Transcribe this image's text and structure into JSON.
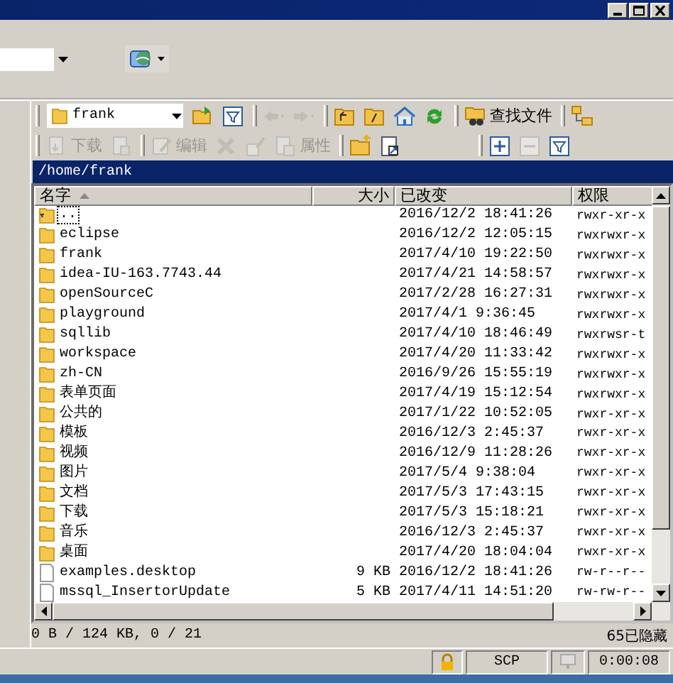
{
  "top_bar": {
    "globe_menu": true
  },
  "toolbar_1": {
    "path": "frank",
    "groups": [
      [
        {
          "kind": "open-folder",
          "disabled": false
        },
        {
          "kind": "filter",
          "disabled": false
        }
      ],
      [
        {
          "kind": "back",
          "disabled": true
        },
        {
          "kind": "forward",
          "disabled": true
        }
      ],
      [
        {
          "kind": "parent",
          "disabled": false
        },
        {
          "kind": "root",
          "disabled": false
        },
        {
          "kind": "home",
          "disabled": false
        },
        {
          "kind": "refresh",
          "disabled": false
        }
      ],
      [
        {
          "kind": "find",
          "label": "查找文件",
          "disabled": false
        }
      ],
      [
        {
          "kind": "tree",
          "disabled": false
        }
      ]
    ]
  },
  "toolbar_2": {
    "groups": [
      [
        {
          "kind": "download",
          "label": "下载",
          "disabled": true
        },
        {
          "kind": "download-options",
          "disabled": true
        }
      ],
      [
        {
          "kind": "edit",
          "label": "编辑",
          "disabled": true
        },
        {
          "kind": "delete",
          "disabled": true
        },
        {
          "kind": "rename",
          "disabled": true
        },
        {
          "kind": "properties",
          "label": "属性",
          "disabled": true
        }
      ],
      [
        {
          "kind": "new-folder",
          "disabled": false
        },
        {
          "kind": "shortcut",
          "disabled": false
        }
      ],
      [
        {
          "kind": "select",
          "disabled": false
        },
        {
          "kind": "unselect",
          "disabled": true
        },
        {
          "kind": "filter",
          "disabled": false
        }
      ]
    ]
  },
  "path_header": "/home/frank",
  "table": {
    "columns": [
      {
        "label": "名字",
        "sorted": true
      },
      {
        "label": "大小",
        "sorted": false
      },
      {
        "label": "已改变",
        "sorted": false
      },
      {
        "label": "权限",
        "sorted": false
      }
    ],
    "rows": [
      {
        "kind": "parent",
        "name": "..",
        "size": "",
        "changed": "2016/12/2 18:41:26",
        "permissions": "rwxr-xr-x",
        "focused": true
      },
      {
        "kind": "folder",
        "name": "eclipse",
        "changed": "2016/12/2 12:05:15",
        "permissions": "rwxrwxr-x",
        "focused": false
      },
      {
        "kind": "folder",
        "name": "frank",
        "changed": "2017/4/10 19:22:50",
        "permissions": "rwxrwxr-x",
        "focused": false
      },
      {
        "kind": "folder",
        "name": "idea-IU-163.7743.44",
        "changed": "2017/4/21 14:58:57",
        "permissions": "rwxrwxr-x",
        "focused": false
      },
      {
        "kind": "folder",
        "name": "openSourceC",
        "changed": "2017/2/28 16:27:31",
        "permissions": "rwxrwxr-x",
        "focused": false
      },
      {
        "kind": "folder",
        "name": "playground",
        "changed": "2017/4/1 9:36:45",
        "permissions": "rwxrwxr-x",
        "focused": false
      },
      {
        "kind": "folder",
        "name": "sqllib",
        "changed": "2017/4/10 18:46:49",
        "permissions": "rwxrwsr-t",
        "focused": false
      },
      {
        "kind": "folder",
        "name": "workspace",
        "changed": "2017/4/20 11:33:42",
        "permissions": "rwxrwxr-x",
        "focused": false
      },
      {
        "kind": "folder",
        "name": "zh-CN",
        "changed": "2016/9/26 15:55:19",
        "permissions": "rwxrwxr-x",
        "focused": false
      },
      {
        "kind": "folder",
        "name": "表单页面",
        "changed": "2017/4/19 15:12:54",
        "permissions": "rwxrwxr-x",
        "focused": false
      },
      {
        "kind": "folder",
        "name": "公共的",
        "changed": "2017/1/22 10:52:05",
        "permissions": "rwxr-xr-x",
        "focused": false
      },
      {
        "kind": "folder",
        "name": "模板",
        "changed": "2016/12/3 2:45:37",
        "permissions": "rwxr-xr-x",
        "focused": false
      },
      {
        "kind": "folder",
        "name": "视频",
        "changed": "2016/12/9 11:28:26",
        "permissions": "rwxr-xr-x",
        "focused": false
      },
      {
        "kind": "folder",
        "name": "图片",
        "changed": "2017/5/4 9:38:04",
        "permissions": "rwxr-xr-x",
        "focused": false
      },
      {
        "kind": "folder",
        "name": "文档",
        "changed": "2017/5/3 17:43:15",
        "permissions": "rwxr-xr-x",
        "focused": false
      },
      {
        "kind": "folder",
        "name": "下载",
        "changed": "2017/5/3 15:18:21",
        "permissions": "rwxr-xr-x",
        "focused": false
      },
      {
        "kind": "folder",
        "name": "音乐",
        "changed": "2016/12/3 2:45:37",
        "permissions": "rwxr-xr-x",
        "focused": false
      },
      {
        "kind": "folder",
        "name": "桌面",
        "changed": "2017/4/20 18:04:04",
        "permissions": "rwxr-xr-x",
        "focused": false
      },
      {
        "kind": "file",
        "name": "examples.desktop",
        "size": "9 KB",
        "changed": "2016/12/2 18:41:26",
        "permissions": "rw-r--r--",
        "focused": false
      },
      {
        "kind": "file",
        "name": "mssql_InsertorUpdate",
        "size": "5 KB",
        "changed": "2017/4/11 14:51:20",
        "permissions": "rw-rw-r--",
        "focused": false
      }
    ]
  },
  "status": {
    "selection": "0 B / 124 KB,  0 / 21",
    "hidden": "65已隐藏"
  },
  "bottom_bar": {
    "protocol": "SCP",
    "elapsed": "0:00:08"
  }
}
